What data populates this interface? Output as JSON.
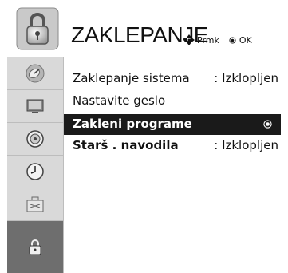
{
  "header": {
    "title": "ZAKLEPANJE",
    "hint_move": "Prmk",
    "hint_ok": "OK",
    "icon": "padlock-icon"
  },
  "sidebar": {
    "items": [
      {
        "icon": "satellite-dish-icon",
        "active": false
      },
      {
        "icon": "tv-picture-icon",
        "active": false
      },
      {
        "icon": "speaker-icon",
        "active": false
      },
      {
        "icon": "clock-icon",
        "active": false
      },
      {
        "icon": "toolbox-icon",
        "active": false
      },
      {
        "icon": "padlock-icon",
        "active": true
      }
    ]
  },
  "menu": {
    "items": [
      {
        "label": "Zaklepanje sistema",
        "value": ": Izklopljen"
      },
      {
        "label": "Nastavite geslo",
        "value": ""
      },
      {
        "label": "Zakleni programe",
        "value": ""
      },
      {
        "label": "Starš  . navodila",
        "value": ": Izklopljen"
      }
    ]
  },
  "colors": {
    "selected_bg": "#1a1a1a",
    "sidebar_bg": "#d9d9d9",
    "sidebar_active": "#6e6e6e"
  }
}
